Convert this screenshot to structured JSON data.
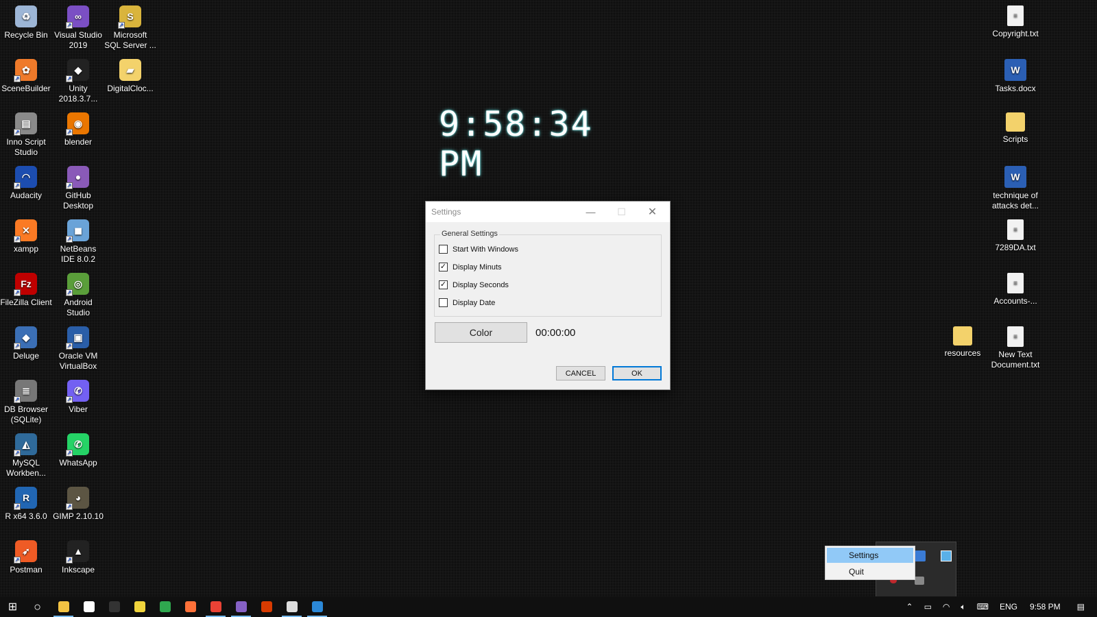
{
  "clock": {
    "time": "9:58:34 PM"
  },
  "desktop_left": [
    {
      "label": "Recycle Bin",
      "icon": "recycle-bin-icon",
      "color": "#9db6d6",
      "glyph": "♻"
    },
    {
      "label": "Visual Studio 2019",
      "icon": "visual-studio-icon",
      "color": "#7b4fc4",
      "glyph": "∞"
    },
    {
      "label": "Microsoft SQL Server ...",
      "icon": "sql-server-icon",
      "color": "#d9b43c",
      "glyph": "S"
    },
    {
      "label": "SceneBuilder",
      "icon": "scenebuilder-icon",
      "color": "#ef7a2a",
      "glyph": "✿"
    },
    {
      "label": "Unity 2018.3.7...",
      "icon": "unity-icon",
      "color": "#222222",
      "glyph": "◆"
    },
    {
      "label": "DigitalCloc...",
      "icon": "folder-icon",
      "color": "#f3d26b",
      "glyph": "▰"
    },
    {
      "label": "Inno Script Studio",
      "icon": "inno-script-icon",
      "color": "#8a8a8a",
      "glyph": "▤"
    },
    {
      "label": "blender",
      "icon": "blender-icon",
      "color": "#ea7600",
      "glyph": "◉"
    },
    {
      "label": "Audacity",
      "icon": "audacity-icon",
      "color": "#1c4db0",
      "glyph": "◠"
    },
    {
      "label": "GitHub Desktop",
      "icon": "github-desktop-icon",
      "color": "#8a5ab8",
      "glyph": "●"
    },
    {
      "label": "xampp",
      "icon": "xampp-icon",
      "color": "#fb7a24",
      "glyph": "✕"
    },
    {
      "label": "NetBeans IDE 8.0.2",
      "icon": "netbeans-icon",
      "color": "#6aa3d8",
      "glyph": "◼"
    },
    {
      "label": "FileZilla Client",
      "icon": "filezilla-icon",
      "color": "#bf0000",
      "glyph": "Fz"
    },
    {
      "label": "Android Studio",
      "icon": "android-studio-icon",
      "color": "#5a9e3a",
      "glyph": "◎"
    },
    {
      "label": "Deluge",
      "icon": "deluge-icon",
      "color": "#3b6fb5",
      "glyph": "◆"
    },
    {
      "label": "Oracle VM VirtualBox",
      "icon": "virtualbox-icon",
      "color": "#2a5ea8",
      "glyph": "▣"
    },
    {
      "label": "DB Browser (SQLite)",
      "icon": "db-browser-icon",
      "color": "#777777",
      "glyph": "≣"
    },
    {
      "label": "Viber",
      "icon": "viber-icon",
      "color": "#7360f2",
      "glyph": "✆"
    },
    {
      "label": "MySQL Workben...",
      "icon": "mysql-workbench-icon",
      "color": "#2f6a9a",
      "glyph": "◭"
    },
    {
      "label": "WhatsApp",
      "icon": "whatsapp-icon",
      "color": "#25d366",
      "glyph": "✆"
    },
    {
      "label": "R x64 3.6.0",
      "icon": "r-icon",
      "color": "#2166b3",
      "glyph": "R"
    },
    {
      "label": "GIMP 2.10.10",
      "icon": "gimp-icon",
      "color": "#5c5543",
      "glyph": "◕"
    },
    {
      "label": "Postman",
      "icon": "postman-icon",
      "color": "#ef5b25",
      "glyph": "➶"
    },
    {
      "label": "Inkscape",
      "icon": "inkscape-icon",
      "color": "#222222",
      "glyph": "▲"
    }
  ],
  "desktop_right": [
    {
      "label": "Copyright.txt",
      "icon": "text-file-icon",
      "kind": "file"
    },
    {
      "label": "Tasks.docx",
      "icon": "word-doc-icon",
      "kind": "word"
    },
    {
      "label": "Scripts",
      "icon": "folder-icon",
      "kind": "folder"
    },
    {
      "label": "technique of attacks det...",
      "icon": "word-doc-icon",
      "kind": "word"
    },
    {
      "label": "7289DA.txt",
      "icon": "text-file-icon",
      "kind": "file"
    },
    {
      "label": "Accounts-...",
      "icon": "image-file-icon",
      "kind": "file"
    },
    {
      "label": "resources",
      "icon": "folder-icon",
      "kind": "folder"
    },
    {
      "label": "New Text Document.txt",
      "icon": "text-file-icon",
      "kind": "file"
    }
  ],
  "settings_window": {
    "title": "Settings",
    "group_title": "General Settings",
    "options": [
      {
        "label": "Start With Windows",
        "checked": false
      },
      {
        "label": "Display Minuts",
        "checked": true
      },
      {
        "label": "Display Seconds",
        "checked": true
      },
      {
        "label": "Display Date",
        "checked": false
      }
    ],
    "color_button": "Color",
    "time_value": "00:00:00",
    "cancel": "CANCEL",
    "ok": "OK"
  },
  "context_menu": {
    "items": [
      "Settings",
      "Quit"
    ]
  },
  "taskbar": {
    "language": "ENG",
    "time": "9:58 PM",
    "pinned": [
      {
        "icon": "file-explorer-icon",
        "color": "#f3c343",
        "active": true
      },
      {
        "icon": "mail-icon",
        "color": "#ffffff",
        "active": false
      },
      {
        "icon": "terminal-icon",
        "color": "#333333",
        "active": false
      },
      {
        "icon": "git-icon",
        "color": "#f0d43c",
        "active": false
      },
      {
        "icon": "edge-icon",
        "color": "#2fa84f",
        "active": false
      },
      {
        "icon": "firefox-icon",
        "color": "#ff7139",
        "active": false
      },
      {
        "icon": "chrome-icon",
        "color": "#e94235",
        "active": true
      },
      {
        "icon": "visual-studio-icon",
        "color": "#8661c5",
        "active": true
      },
      {
        "icon": "app-grid-icon",
        "color": "#d83b01",
        "active": false
      },
      {
        "icon": "photos-icon",
        "color": "#dddddd",
        "active": true
      },
      {
        "icon": "app-window-icon",
        "color": "#2b88d8",
        "active": true
      }
    ]
  }
}
